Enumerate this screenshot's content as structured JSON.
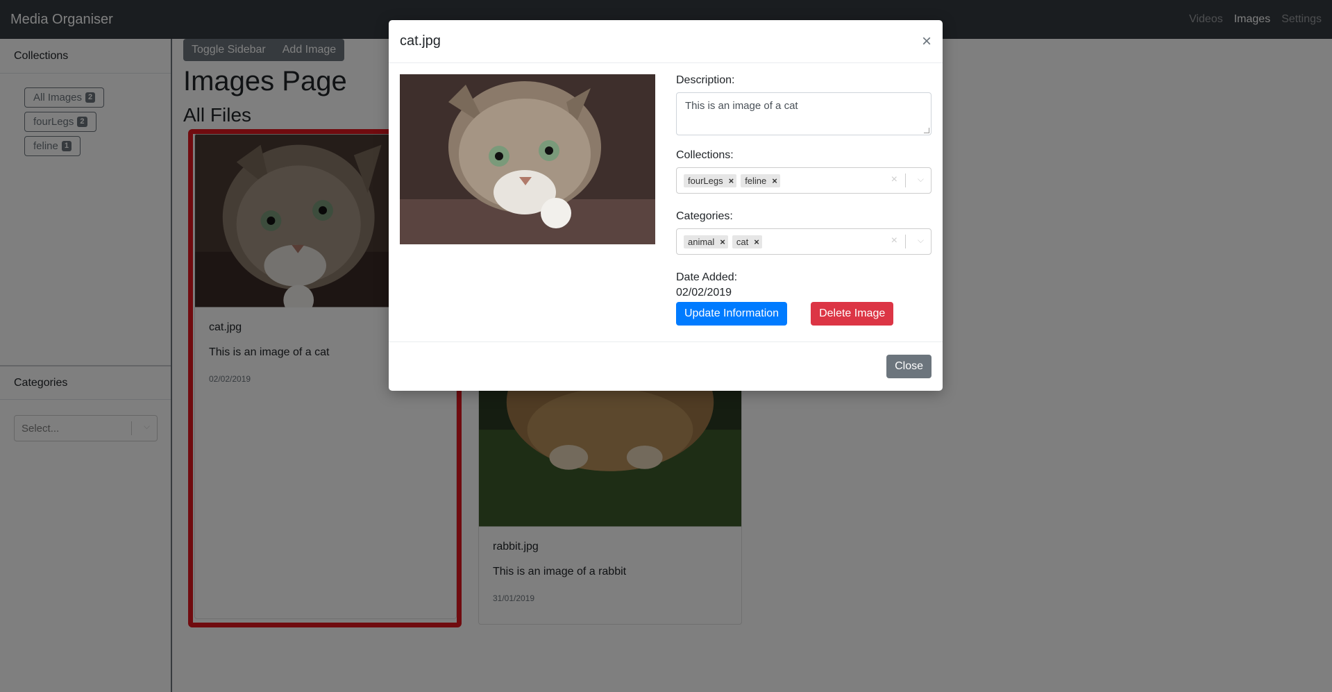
{
  "navbar": {
    "brand": "Media Organiser",
    "links": [
      {
        "label": "Videos",
        "active": false
      },
      {
        "label": "Images",
        "active": true
      },
      {
        "label": "Settings",
        "active": false
      }
    ]
  },
  "sidebar": {
    "collections_heading": "Collections",
    "collections": [
      {
        "label": "All Images",
        "count": "2"
      },
      {
        "label": "fourLegs",
        "count": "2"
      },
      {
        "label": "feline",
        "count": "1"
      }
    ],
    "categories_heading": "Categories",
    "categories_placeholder": "Select..."
  },
  "toolbar": {
    "toggle_sidebar": "Toggle Sidebar",
    "add_image": "Add Image"
  },
  "page": {
    "title": "Images Page",
    "section": "All Files"
  },
  "cards": [
    {
      "title": "cat.jpg",
      "description": "This is an image of a cat",
      "date": "02/02/2019",
      "image_icon": "cat-photo"
    },
    {
      "title": "rabbit.jpg",
      "description": "This is an image of a rabbit",
      "date": "31/01/2019",
      "image_icon": "rabbit-photo"
    }
  ],
  "modal": {
    "title": "cat.jpg",
    "image_icon": "cat-photo",
    "description_label": "Description:",
    "description_value": "This is an image of a cat",
    "collections_label": "Collections:",
    "collections_tags": [
      "fourLegs",
      "feline"
    ],
    "categories_label": "Categories:",
    "categories_tags": [
      "animal",
      "cat"
    ],
    "date_label": "Date Added:",
    "date_value": "02/02/2019",
    "update_button": "Update Information",
    "delete_button": "Delete Image",
    "close_button": "Close"
  },
  "colors": {
    "navbar": "#343a40",
    "primary": "#007bff",
    "danger": "#dc3545",
    "secondary": "#6c757d",
    "highlight": "#e0161e"
  }
}
